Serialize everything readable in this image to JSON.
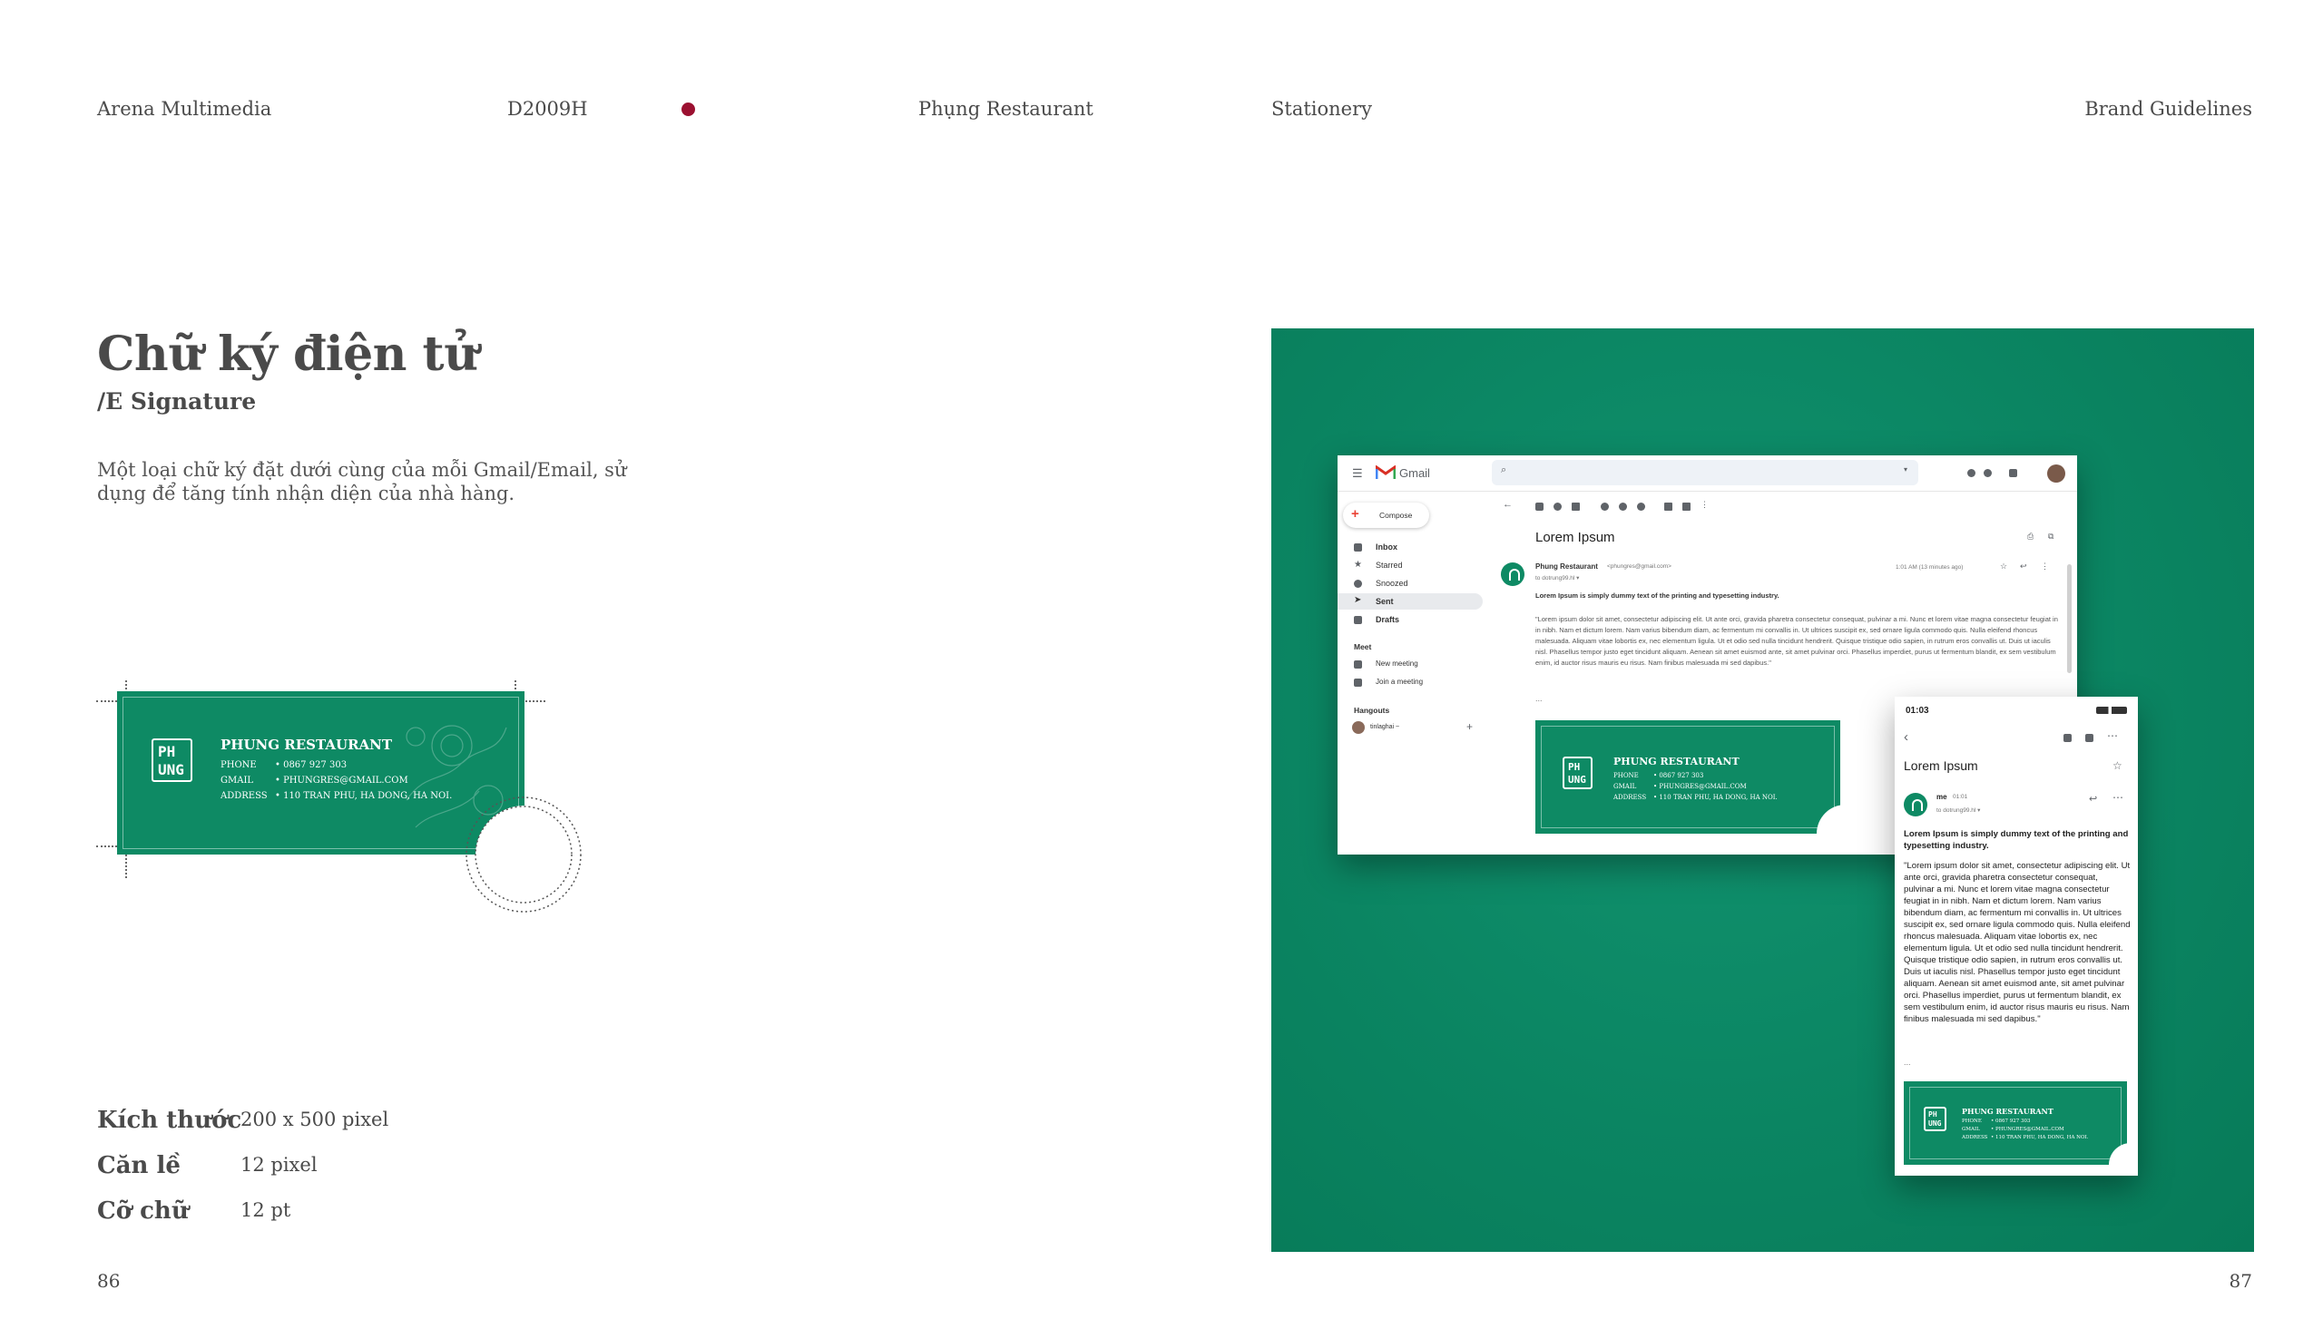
{
  "header": {
    "school": "Arena Multimedia",
    "class_code": "D2009H",
    "project": "Phụng Restaurant",
    "section": "Stationery",
    "doc": "Brand Guidelines"
  },
  "colors": {
    "accent_dot": "#9b1030",
    "brand_green": "#0e8a64",
    "text": "#4a4a4a"
  },
  "title": "Chữ ký điện tử",
  "subtitle": "/E Signature",
  "description": "Một loại chữ ký đặt dưới cùng của mỗi Gmail/Email, sử dụng để tăng tính nhận diện của nhà hàng.",
  "signature": {
    "logo_text": "PHUNG",
    "name": "PHUNG RESTAURANT",
    "rows": [
      {
        "label": "PHONE",
        "value": "•  0867 927 303"
      },
      {
        "label": "GMAIL",
        "value": "•  PHUNGRES@GMAIL.COM"
      },
      {
        "label": "ADDRESS",
        "value": "•  110 TRAN PHU, HA DONG, HA NOI."
      }
    ]
  },
  "specs": [
    {
      "label": "Kích thước",
      "value": "200 x 500 pixel"
    },
    {
      "label": "Căn lề",
      "value": "12 pixel"
    },
    {
      "label": "Cỡ chữ",
      "value": "12 pt"
    }
  ],
  "page_left": "86",
  "page_right": "87",
  "gmail": {
    "brand": "Gmail",
    "compose": "Compose",
    "nav": [
      "Inbox",
      "Starred",
      "Snoozed",
      "Sent",
      "Drafts"
    ],
    "meet_title": "Meet",
    "meet_items": [
      "New meeting",
      "Join a meeting"
    ],
    "hangouts_title": "Hangouts",
    "hangouts_user": "tinlaghai ~",
    "subject": "Lorem Ipsum",
    "sender": "Phung Restaurant",
    "sender_email": "<phungres@gmail.com>",
    "to": "to dotrung99.hl ▾",
    "time": "1:01 AM (13 minutes ago)",
    "lead": "Lorem Ipsum is simply dummy text of the printing and typesetting industry.",
    "body": "\"Lorem ipsum dolor sit amet, consectetur adipiscing elit. Ut ante orci, gravida pharetra consectetur consequat, pulvinar a mi. Nunc et lorem vitae magna consectetur feugiat in in nibh. Nam et dictum lorem. Nam varius bibendum diam, ac fermentum mi convallis in. Ut ultrices suscipit ex, sed ornare ligula commodo quis. Nulla eleifend rhoncus malesuada. Aliquam vitae lobortis ex, nec elementum ligula. Ut et odio sed nulla tincidunt hendrerit. Quisque tristique odio sapien, in rutrum eros convallis ut. Duis ut iaculis nisl. Phasellus tempor justo eget tincidunt aliquam. Aenean sit amet euismod ante, sit amet pulvinar orci. Phasellus imperdiet, purus ut fermentum blandit, ex sem vestibulum enim, id auctor risus mauris eu risus. Nam finibus malesuada mi sed dapibus.\"",
    "ellipsis": "..."
  },
  "mobile": {
    "time": "01:03",
    "subject": "Lorem Ipsum",
    "sender": "me",
    "sender_time": "01:01",
    "to": "to dotrung99.hl ▾",
    "lead": "Lorem Ipsum is simply dummy text of the printing and typesetting industry.",
    "body": "\"Lorem ipsum dolor sit amet, consectetur adipiscing elit. Ut ante orci, gravida pharetra consectetur consequat, pulvinar a mi. Nunc et lorem vitae magna consectetur feugiat in in nibh. Nam et dictum lorem. Nam varius bibendum diam, ac fermentum mi convallis in. Ut ultrices suscipit ex, sed ornare ligula commodo quis. Nulla eleifend rhoncus malesuada. Aliquam vitae lobortis ex, nec elementum ligula. Ut et odio sed nulla tincidunt hendrerit. Quisque tristique odio sapien, in rutrum eros convallis ut. Duis ut iaculis nisl. Phasellus tempor justo eget tincidunt aliquam. Aenean sit amet euismod ante, sit amet pulvinar orci. Phasellus imperdiet, purus ut fermentum blandit, ex sem vestibulum enim, id auctor risus mauris eu risus. Nam finibus malesuada mi sed dapibus.\"",
    "ellipsis": "..."
  }
}
